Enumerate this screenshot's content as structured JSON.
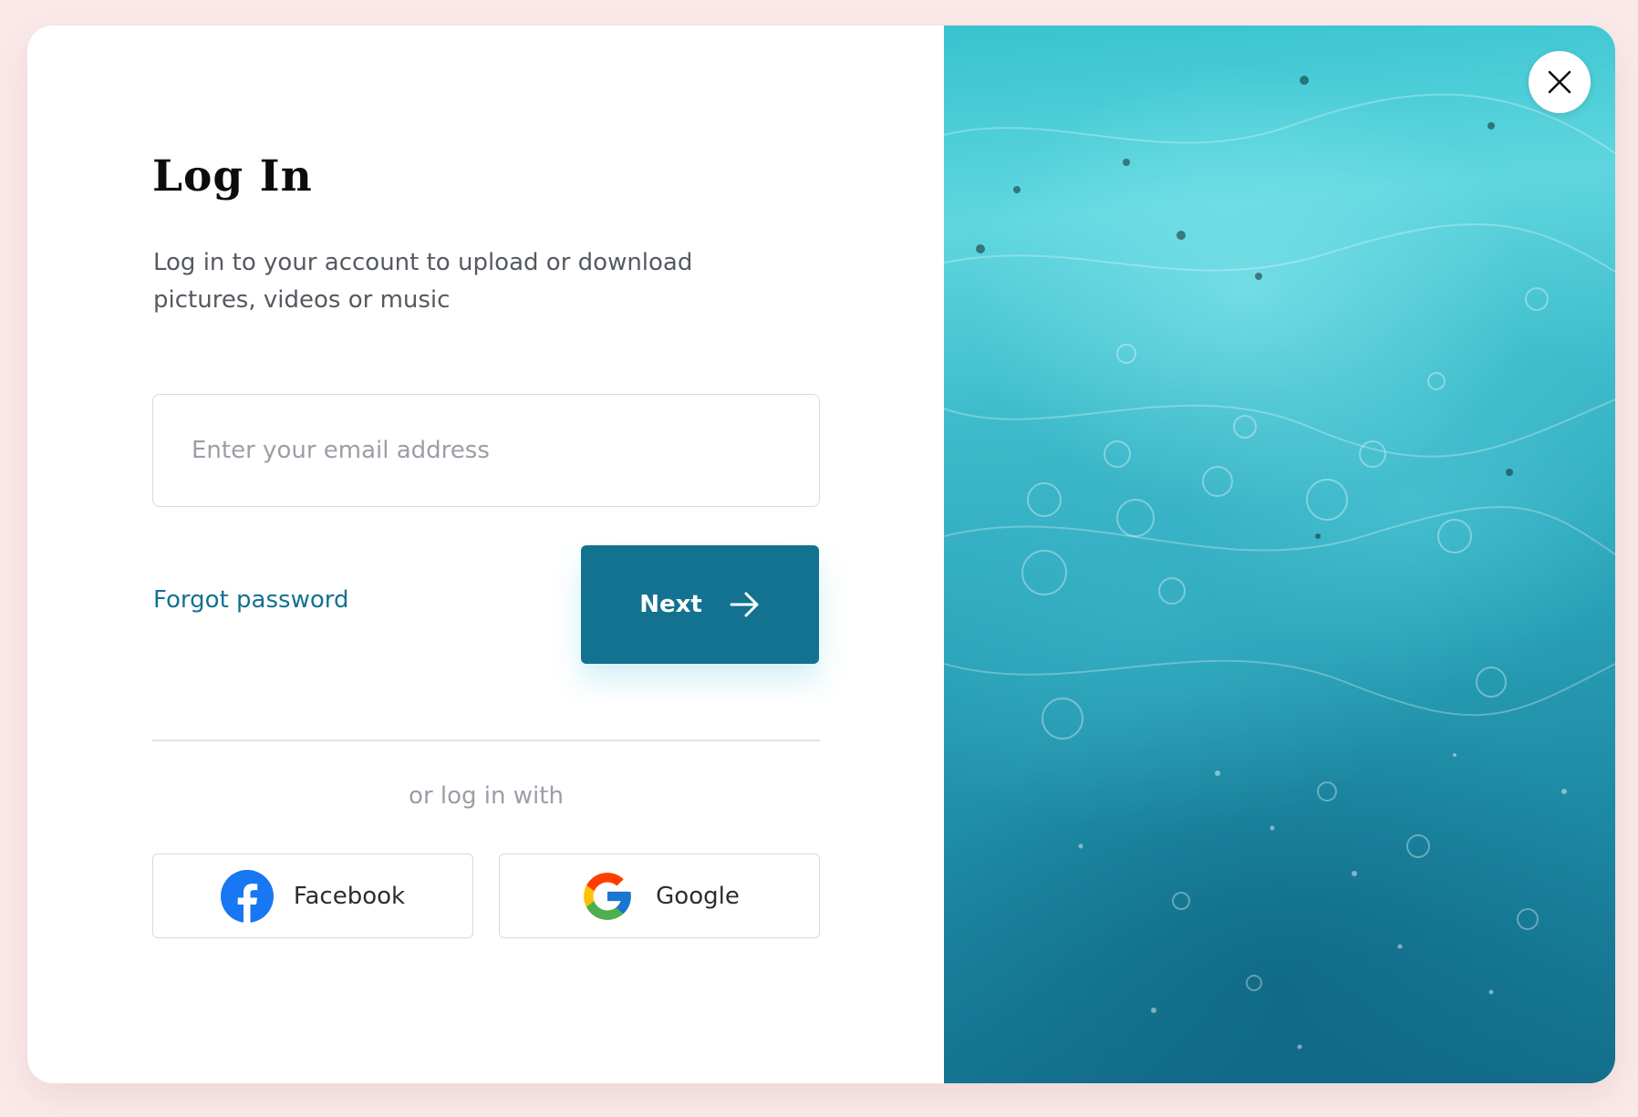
{
  "login": {
    "title": "Log In",
    "subtitle_line1": "Log in to your account to upload or download",
    "subtitle_line2": "pictures, videos or music",
    "email_placeholder": "Enter your email address",
    "email_value": "",
    "forgot_password": "Forgot password",
    "next_label": "Next",
    "or_text": "or log in with",
    "facebook_label": "Facebook",
    "google_label": "Google"
  },
  "colors": {
    "accent": "#127290",
    "page_background": "#fbe9e9",
    "facebook_blue": "#1877f2"
  },
  "icons": {
    "next": "arrow-right-icon",
    "close": "close-icon",
    "facebook": "facebook-icon",
    "google": "google-icon"
  }
}
